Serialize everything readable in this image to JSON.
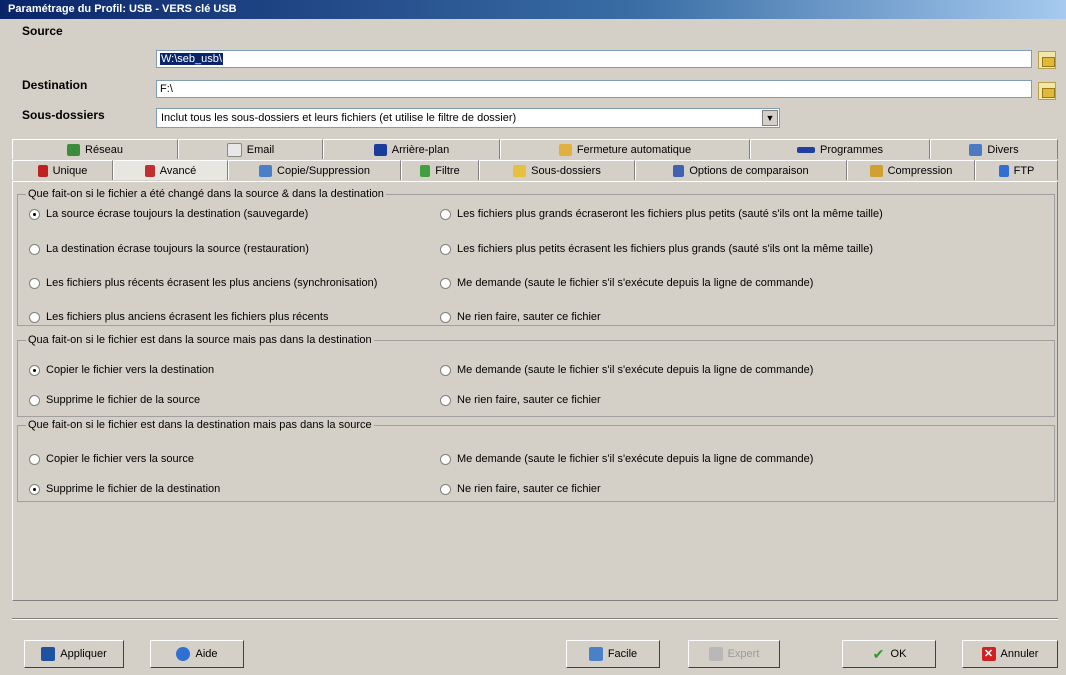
{
  "window": {
    "title": "Paramétrage du Profil: USB - VERS clé USB"
  },
  "source": {
    "label": "Source",
    "value": "W:\\seb_usb\\"
  },
  "destination": {
    "label": "Destination",
    "value": "F:\\"
  },
  "subfolders": {
    "label": "Sous-dossiers",
    "value": "Inclut tous les sous-dossiers et leurs fichiers (et utilise le filtre de dossier)"
  },
  "tabs_top": [
    "Réseau",
    "Email",
    "Arrière-plan",
    "Fermeture automatique",
    "Programmes",
    "Divers"
  ],
  "tabs_bottom": [
    "Unique",
    "Avancé",
    "Copie/Suppression",
    "Filtre",
    "Sous-dossiers",
    "Options de comparaison",
    "Compression",
    "FTP"
  ],
  "active_tab": "Avancé",
  "group1": {
    "title": "Que fait-on si le fichier a été changé dans la source & dans la destination",
    "options": [
      "La source écrase toujours la destination (sauvegarde)",
      "La destination écrase toujours la source (restauration)",
      "Les fichiers plus récents écrasent les plus anciens (synchronisation)",
      "Les fichiers plus anciens écrasent les fichiers plus récents",
      "Les fichiers plus grands écraseront les fichiers plus petits (sauté s'ils ont la même taille)",
      "Les fichiers plus petits écrasent les fichiers plus grands (sauté s'ils ont la même taille)",
      "Me demande (saute le fichier s'il s'exécute depuis la ligne de commande)",
      "Ne rien faire, sauter ce fichier"
    ],
    "selected": 0
  },
  "group2": {
    "title": "Qua fait-on si le fichier est dans la source mais pas dans la destination",
    "options": [
      "Copier le fichier vers la destination",
      "Supprime le fichier de la source",
      "Me demande (saute le fichier s'il s'exécute depuis la ligne de commande)",
      "Ne rien faire, sauter ce fichier"
    ],
    "selected": 0
  },
  "group3": {
    "title": "Que fait-on si le fichier est dans la destination mais pas dans la source",
    "options": [
      "Copier le fichier vers la source",
      "Supprime le fichier de la destination",
      "Me demande (saute le fichier s'il s'exécute depuis la ligne de commande)",
      "Ne rien faire, sauter ce fichier"
    ],
    "selected": 1
  },
  "buttons": {
    "apply": "Appliquer",
    "help": "Aide",
    "easy": "Facile",
    "expert": "Expert",
    "ok": "OK",
    "cancel": "Annuler"
  }
}
